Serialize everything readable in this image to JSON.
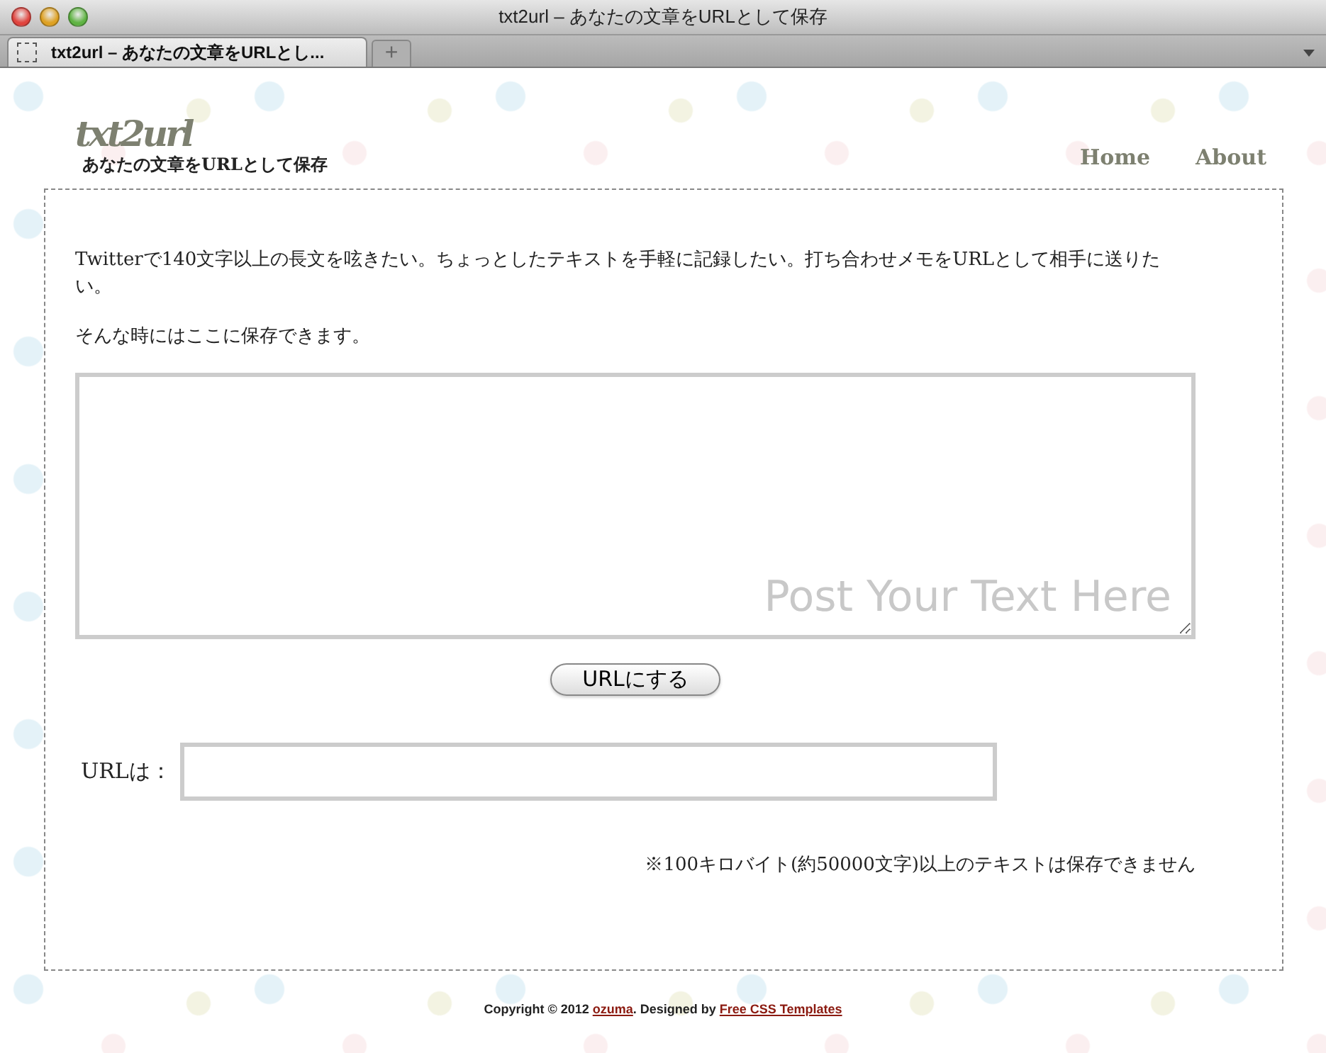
{
  "window": {
    "title": "txt2url – あなたの文章をURLとして保存"
  },
  "tabs": [
    {
      "label": "txt2url – あなたの文章をURLとし...",
      "selected": true
    }
  ],
  "new_tab": "+",
  "header": {
    "logo": "txt2url",
    "tagline": "あなたの文章をURLとして保存"
  },
  "nav": [
    {
      "label": "Home"
    },
    {
      "label": "About"
    }
  ],
  "intro": [
    "Twitterで140文字以上の長文を呟きたい。ちょっとしたテキストを手軽に記録したい。打ち合わせメモをURLとして相手に送りたい。",
    "そんな時にはここに保存できます。"
  ],
  "text_area": {
    "placeholder": "Post Your Text Here"
  },
  "submit_button": "URLにする",
  "url_field": {
    "label": "URLは："
  },
  "note": "※100キロバイト(約50000文字)以上のテキストは保存できません",
  "footer": {
    "copyright": "Copyright © 2012",
    "author_link": "ozuma",
    "designed_by": ". Designed by",
    "designer_link": "Free CSS Templates"
  }
}
